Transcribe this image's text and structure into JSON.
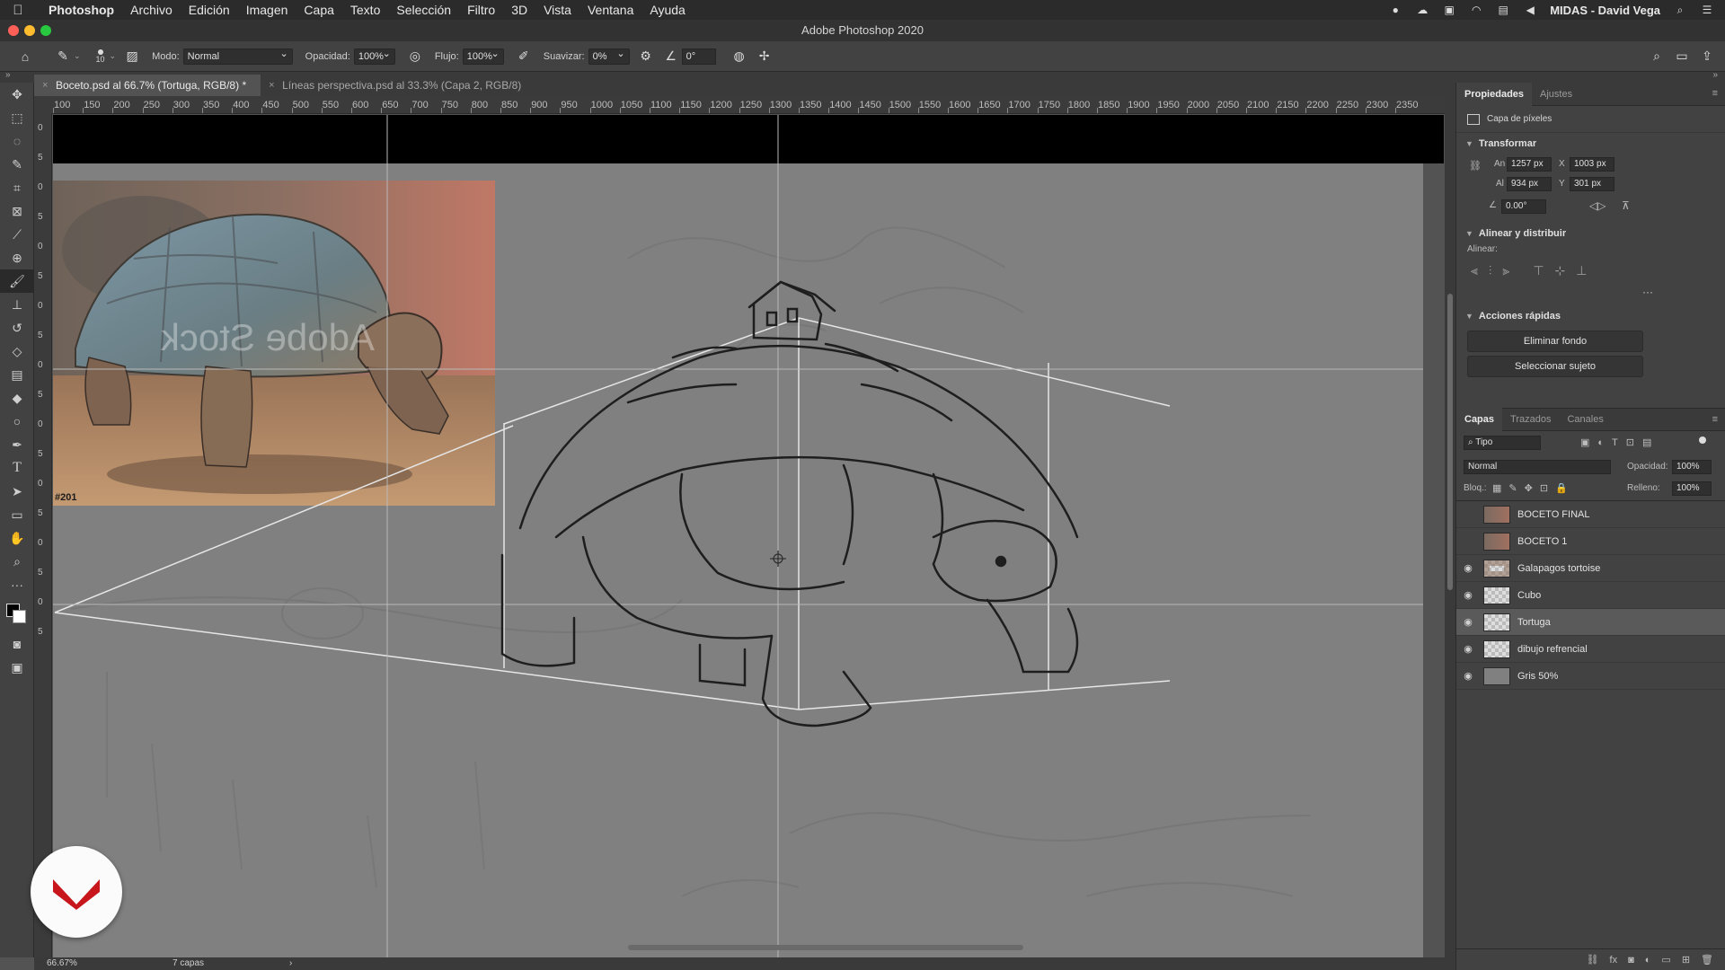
{
  "menubar": {
    "app_name": "Photoshop",
    "items": [
      "Archivo",
      "Edición",
      "Imagen",
      "Capa",
      "Texto",
      "Selección",
      "Filtro",
      "3D",
      "Vista",
      "Ventana",
      "Ayuda"
    ],
    "user": "MIDAS - David Vega"
  },
  "window": {
    "title": "Adobe Photoshop 2020"
  },
  "options": {
    "brush_size": "10",
    "mode_label": "Modo:",
    "mode_value": "Normal",
    "opacity_label": "Opacidad:",
    "opacity_value": "100%",
    "flow_label": "Flujo:",
    "flow_value": "100%",
    "smooth_label": "Suavizar:",
    "smooth_value": "0%",
    "angle_value": "0°"
  },
  "tabs": [
    {
      "label": "Boceto.psd al 66.7% (Tortuga, RGB/8) *",
      "active": true
    },
    {
      "label": "Líneas perspectiva.psd al 33.3% (Capa 2, RGB/8)",
      "active": false
    }
  ],
  "ruler": {
    "h_labels": [
      "100",
      "150",
      "200",
      "250",
      "300",
      "350",
      "400",
      "450",
      "500",
      "550",
      "600",
      "650",
      "700",
      "750",
      "800",
      "850",
      "900",
      "950",
      "1000",
      "1050",
      "1100",
      "1150",
      "1200",
      "1250",
      "1300",
      "1350",
      "1400",
      "1450",
      "1500",
      "1550",
      "1600",
      "1650",
      "1700",
      "1750",
      "1800",
      "1850",
      "1900",
      "1950",
      "2000",
      "2050",
      "2100",
      "2150",
      "2200",
      "2250",
      "2300",
      "2350"
    ],
    "v_labels": [
      "0",
      "5",
      "0",
      "5",
      "0",
      "5",
      "0",
      "5",
      "0",
      "5",
      "0",
      "5",
      "0",
      "5",
      "0",
      "5",
      "0",
      "5"
    ]
  },
  "canvas": {
    "photo_watermark": "Adobe Stock",
    "photo_code": "#201"
  },
  "status": {
    "zoom": "66.67%",
    "layers_count": "7 capas"
  },
  "properties": {
    "tabs": [
      "Propiedades",
      "Ajustes"
    ],
    "pixel_layer_label": "Capa de píxeles",
    "transform_title": "Transformar",
    "w_label": "An",
    "w_value": "1257 px",
    "x_label": "X",
    "x_value": "1003 px",
    "h_label": "Al",
    "h_value": "934 px",
    "y_label": "Y",
    "y_value": "301 px",
    "angle_value": "0.00°",
    "align_title": "Alinear y distribuir",
    "align_label": "Alinear:",
    "quick_title": "Acciones rápidas",
    "remove_bg": "Eliminar fondo",
    "select_subject": "Seleccionar sujeto"
  },
  "layers_panel": {
    "tabs": [
      "Capas",
      "Trazados",
      "Canales"
    ],
    "filter_label": "Tipo",
    "blend_mode": "Normal",
    "opacity_label": "Opacidad:",
    "opacity_value": "100%",
    "lock_label": "Bloq.:",
    "fill_label": "Relleno:",
    "fill_value": "100%",
    "layers": [
      {
        "name": "BOCETO FINAL",
        "visible": false,
        "thumb": "photo",
        "selected": false
      },
      {
        "name": "BOCETO 1",
        "visible": false,
        "thumb": "photo",
        "selected": false
      },
      {
        "name": "Galapagos tortoise",
        "visible": true,
        "thumb": "photo-checker",
        "selected": false
      },
      {
        "name": "Cubo",
        "visible": true,
        "thumb": "checker",
        "selected": false
      },
      {
        "name": "Tortuga",
        "visible": true,
        "thumb": "checker",
        "selected": true
      },
      {
        "name": "dibujo refrencial",
        "visible": true,
        "thumb": "checker",
        "selected": false
      },
      {
        "name": "Gris 50%",
        "visible": true,
        "thumb": "gray",
        "selected": false
      }
    ]
  }
}
